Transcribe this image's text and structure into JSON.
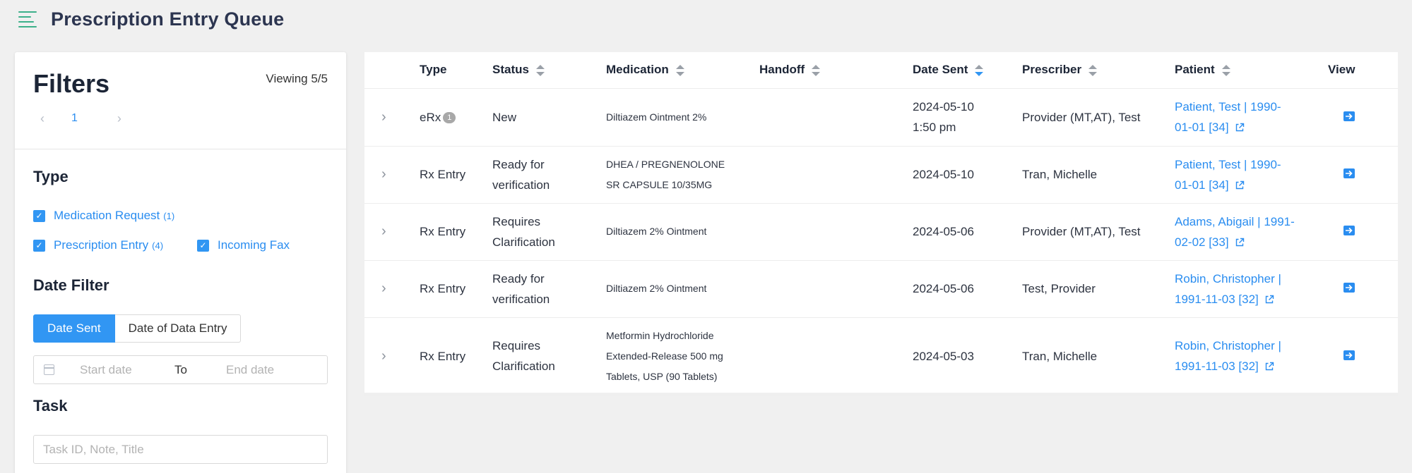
{
  "header": {
    "title": "Prescription Entry Queue"
  },
  "filters": {
    "title": "Filters",
    "viewing": "Viewing 5/5",
    "pager": {
      "current_page": "1"
    },
    "type_section": {
      "title": "Type",
      "options": [
        {
          "label": "Medication Request",
          "count": "(1)",
          "checked": true
        },
        {
          "label": "Prescription Entry",
          "count": "(4)",
          "checked": true
        },
        {
          "label": "Incoming Fax",
          "count": "",
          "checked": true
        }
      ]
    },
    "date_filter": {
      "title": "Date Filter",
      "tabs": [
        "Date Sent",
        "Date of Data Entry"
      ],
      "active_tab": "Date Sent",
      "start_placeholder": "Start date",
      "to_label": "To",
      "end_placeholder": "End date"
    },
    "task": {
      "title": "Task",
      "placeholder": "Task ID, Note, Title"
    }
  },
  "table": {
    "columns": {
      "type": "Type",
      "status": "Status",
      "medication": "Medication",
      "handoff": "Handoff",
      "date_sent": "Date Sent",
      "prescriber": "Prescriber",
      "patient": "Patient",
      "view": "View"
    },
    "rows": [
      {
        "type": "eRx",
        "badge": "1",
        "status_1": "New",
        "status_2": "",
        "med_1": "Diltiazem Ointment 2%",
        "med_2": "",
        "med_3": "",
        "handoff": "",
        "date_1": "2024-05-10",
        "date_2": "1:50 pm",
        "prescriber": "Provider (MT,AT), Test",
        "patient_1": "Patient, Test | 1990-",
        "patient_2": "01-01 [34]"
      },
      {
        "type": "Rx Entry",
        "badge": "",
        "status_1": "Ready for",
        "status_2": "verification",
        "med_1": "DHEA / PREGNENOLONE",
        "med_2": "SR CAPSULE 10/35MG",
        "med_3": "",
        "handoff": "",
        "date_1": "2024-05-10",
        "date_2": "",
        "prescriber": "Tran, Michelle",
        "patient_1": "Patient, Test | 1990-",
        "patient_2": "01-01 [34]"
      },
      {
        "type": "Rx Entry",
        "badge": "",
        "status_1": "Requires",
        "status_2": "Clarification",
        "med_1": "Diltiazem 2% Ointment",
        "med_2": "",
        "med_3": "",
        "handoff": "",
        "date_1": "2024-05-06",
        "date_2": "",
        "prescriber": "Provider (MT,AT), Test",
        "patient_1": "Adams, Abigail | 1991-",
        "patient_2": "02-02 [33]"
      },
      {
        "type": "Rx Entry",
        "badge": "",
        "status_1": "Ready for",
        "status_2": "verification",
        "med_1": "Diltiazem 2% Ointment",
        "med_2": "",
        "med_3": "",
        "handoff": "",
        "date_1": "2024-05-06",
        "date_2": "",
        "prescriber": "Test, Provider",
        "patient_1": "Robin, Christopher |",
        "patient_2": "1991-11-03 [32]"
      },
      {
        "type": "Rx Entry",
        "badge": "",
        "status_1": "Requires",
        "status_2": "Clarification",
        "med_1": "Metformin Hydrochloride",
        "med_2": "Extended-Release 500 mg",
        "med_3": "Tablets, USP (90 Tablets)",
        "handoff": "",
        "date_1": "2024-05-03",
        "date_2": "",
        "prescriber": "Tran, Michelle",
        "patient_1": "Robin, Christopher |",
        "patient_2": "1991-11-03 [32]"
      }
    ]
  },
  "icons": {
    "menu": "menu-icon",
    "prev": "chevron-left-icon",
    "next": "chevron-right-icon",
    "checkbox": "checkmark-icon",
    "calendar": "calendar-icon",
    "expand": "chevron-right-icon",
    "external_link": "external-link-icon",
    "view": "arrow-right-square-icon"
  },
  "colors": {
    "accent": "#3196f3",
    "link": "#2a8df0",
    "menu": "#3db08a",
    "title": "#2c3550"
  }
}
